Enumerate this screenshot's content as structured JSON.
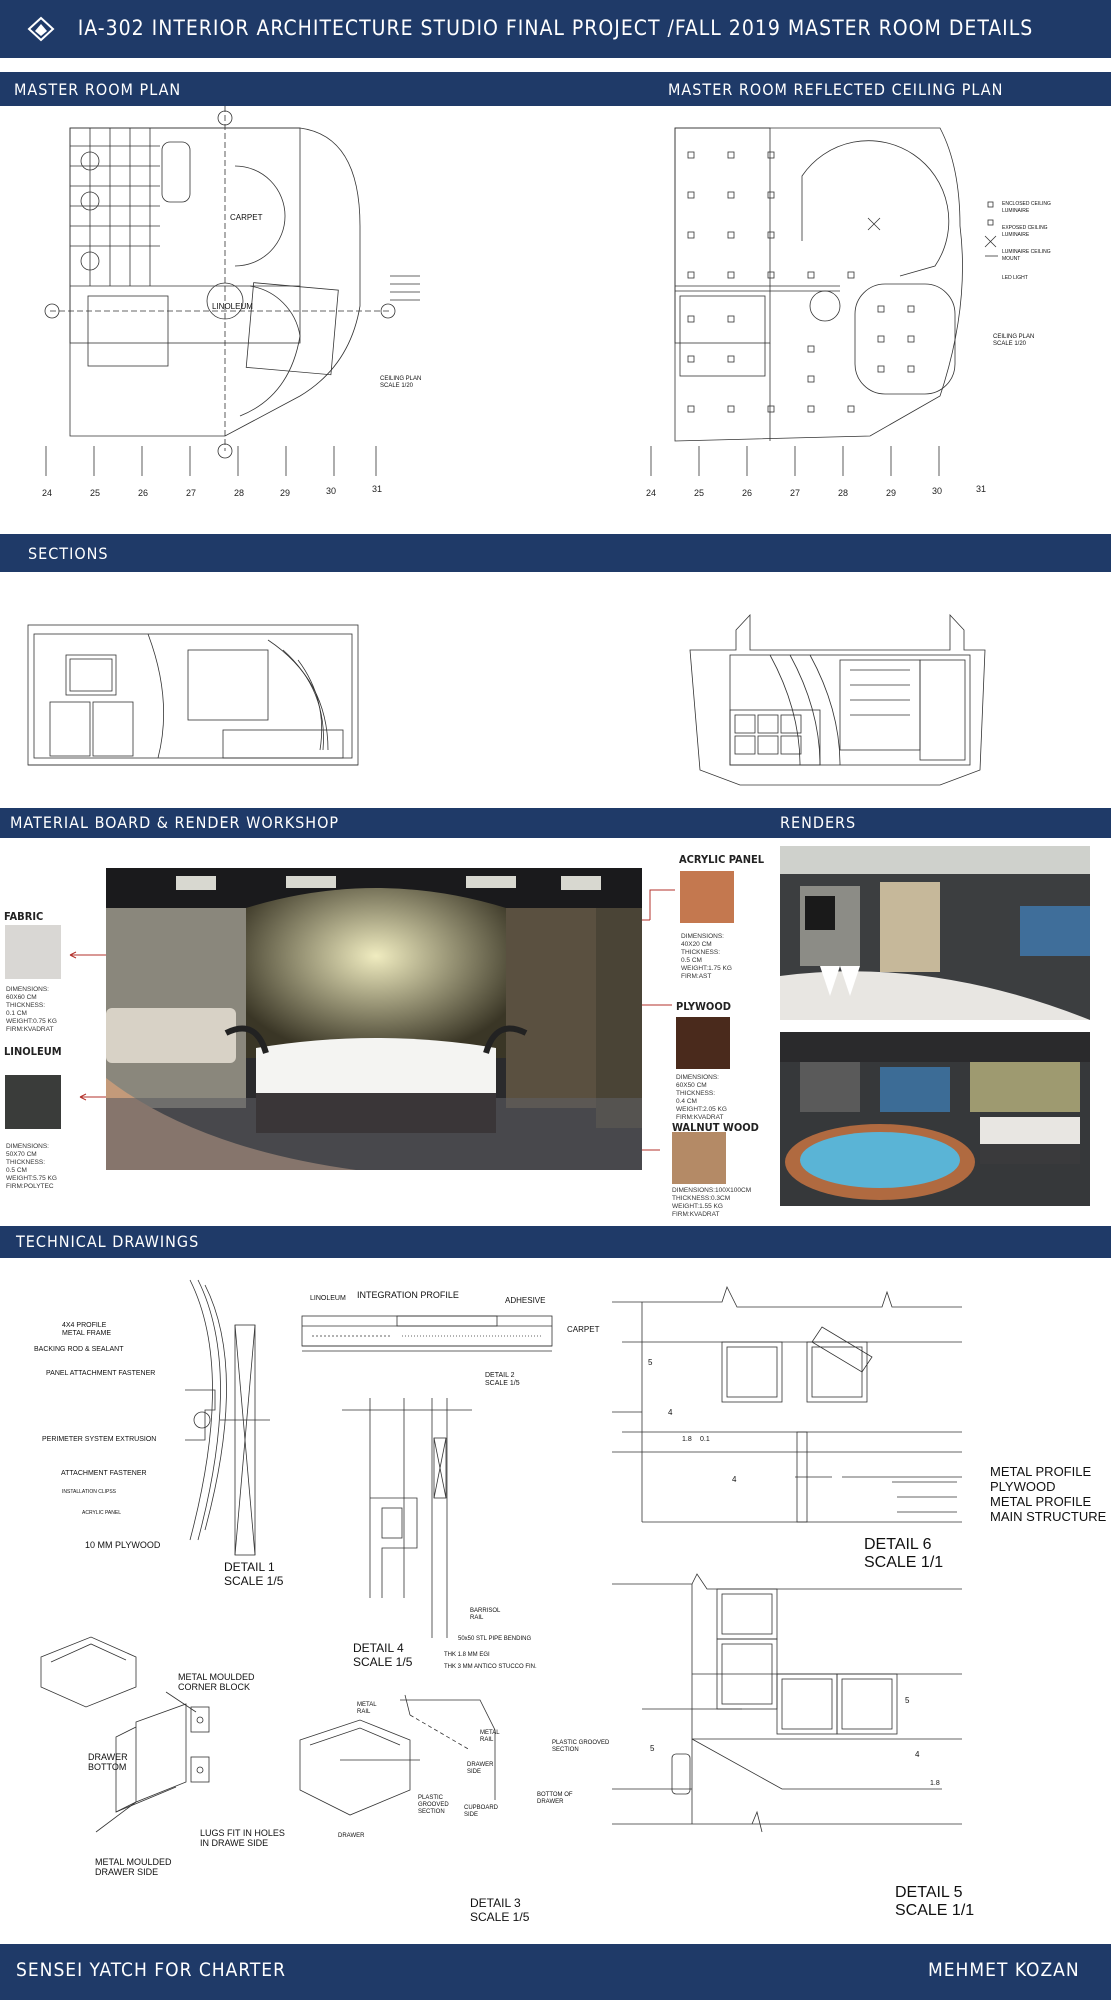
{
  "header": {
    "title": "IA-302 INTERIOR ARCHITECTURE STUDIO FINAL PROJECT /FALL 2019 MASTER ROOM DETAILS"
  },
  "plans": {
    "left_title": "MASTER ROOM PLAN",
    "right_title": "MASTER ROOM REFLECTED CEILING PLAN",
    "axis_labels": [
      "24",
      "25",
      "26",
      "27",
      "28",
      "29",
      "30",
      "31"
    ],
    "room_labels": {
      "carpet": "CARPET",
      "linoleum": "LINOLEUM"
    },
    "plan_scale": "CEILING PLAN\nSCALE 1/20",
    "rcp_scale": "CEILING PLAN\nSCALE 1/20",
    "rcp_legend": [
      "ENCLOSED CEILING LUMINAIRE",
      "EXPOSED CEILING LUMINAIRE",
      "LUMINAIRE CEILING MOUNT",
      "LED LIGHT"
    ]
  },
  "sections": {
    "title": "SECTIONS"
  },
  "materials": {
    "title": "MATERIAL BOARD & RENDER WORKSHOP",
    "fabric": {
      "name": "FABRIC",
      "spec": "DIMENSIONS:\n60X60 CM\nTHICKNESS:\n0.1 CM\nWEIGHT:0.75 KG\nFIRM:KVADRAT",
      "color": "#d9d7d4"
    },
    "linoleum": {
      "name": "LINOLEUM",
      "spec": "DIMENSIONS:\n50X70 CM\nTHICKNESS:\n0.5 CM\nWEIGHT:5.75 KG\nFIRM:POLYTEC",
      "color": "#3a3c3a"
    },
    "acrylic": {
      "name": "ACRYLIC PANEL",
      "spec": "DIMENSIONS:\n40X20 CM\nTHICKNESS:\n0.5 CM\nWEIGHT:1.75 KG\nFIRM:AST",
      "color": "#c4784f"
    },
    "plywood": {
      "name": "PLYWOOD",
      "spec": "DIMENSIONS:\n60X50 CM\nTHICKNESS:\n0.4 CM\nWEIGHT:2.05 KG\nFIRM:KVADRAT",
      "color": "#4a2a1c"
    },
    "walnut": {
      "name": "WALNUT WOOD",
      "spec": "DIMENSIONS:100X100CM\nTHICKNESS:0.3CM\nWEIGHT:1.55 KG\nFIRM:KVADRAT",
      "color": "#b48a66"
    }
  },
  "renders": {
    "title": "RENDERS"
  },
  "technical": {
    "title": "TECHNICAL DRAWINGS",
    "detail1": {
      "title": "DETAIL 1\nSCALE 1/5",
      "labels": [
        "4X4 PROFILE\nMETAL FRAME",
        "BACKING ROD & SEALANT",
        "PANEL ATTACHMENT FASTENER",
        "PERIMETER SYSTEM EXTRUSION",
        "ATTACHMENT FASTENER",
        "INSTALLATION CLIPSS",
        "ACRYLIC PANEL",
        "10 MM PLYWOOD"
      ]
    },
    "detail2": {
      "title": "DETAIL 2\nSCALE 1/5",
      "labels": [
        "LINOLEUM",
        "INTEGRATION PROFILE",
        "ADHESIVE",
        "CARPET"
      ]
    },
    "detail4": {
      "title": "DETAIL 4\nSCALE 1/5",
      "labels": [
        "BARRISOL\nRAIL",
        "50x50 STL PIPE BENDING",
        "THK 1.8 MM EGI",
        "THK 3 MM ANTICO STUCCO FIN."
      ]
    },
    "detail6": {
      "title": "DETAIL 6\nSCALE 1/1",
      "labels": [
        "METAL PROFILE",
        "PLYWOOD",
        "METAL PROFILE",
        "MAIN STRUCTURE"
      ],
      "dims": [
        "5",
        "4",
        "1.8",
        "0.1",
        "4"
      ]
    },
    "drawer": {
      "labels": [
        "METAL MOULDED\nCORNER BLOCK",
        "DRAWER\nBOTTOM",
        "LUGS FIT IN HOLES\nIN DRAWE SIDE",
        "METAL MOULDED\nDRAWER SIDE"
      ]
    },
    "detail3": {
      "title": "DETAIL 3\nSCALE 1/5",
      "labels": [
        "METAL\nRAIL",
        "METAL\nRAIL",
        "PLASTIC GROOVED\nSECTION",
        "DRAWER\nSIDE",
        "BOTTOM OF\nDRAWER",
        "PLASTIC\nGROOVED\nSECTION",
        "CUPBOARD\nSIDE",
        "DRAWER"
      ]
    },
    "detail5": {
      "title": "DETAIL 5\nSCALE 1/1",
      "dims": [
        "5",
        "5",
        "4",
        "1.8"
      ]
    }
  },
  "footer": {
    "left": "SENSEI YATCH FOR CHARTER",
    "right": "MEHMET KOZAN"
  }
}
